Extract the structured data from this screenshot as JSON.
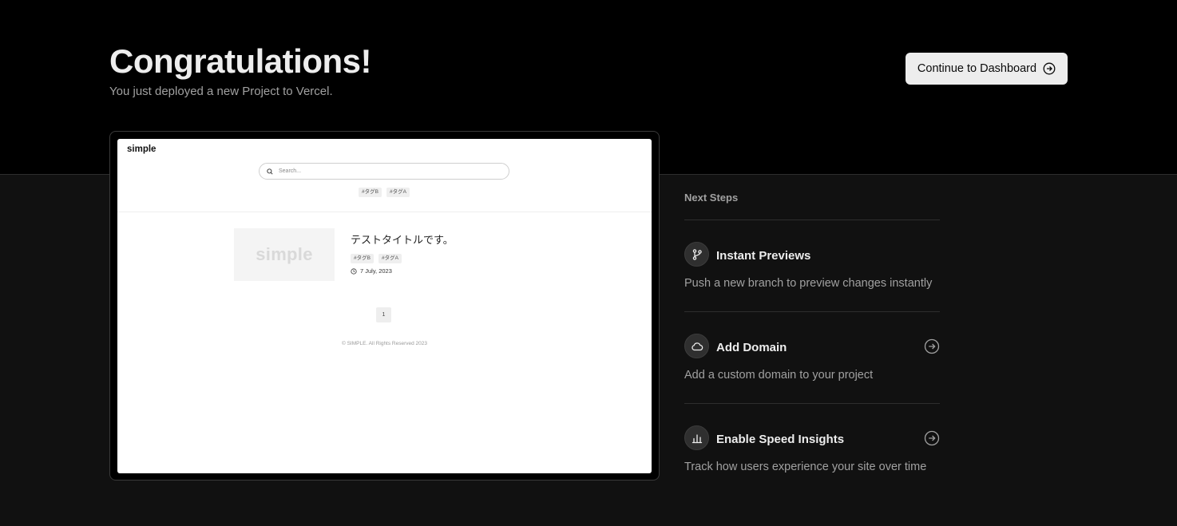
{
  "header": {
    "title": "Congratulations!",
    "subtitle": "You just deployed a new Project to Vercel.",
    "dashboard_button": "Continue to Dashboard"
  },
  "preview": {
    "logo": "simple",
    "search_placeholder": "Search...",
    "top_tags": [
      "#タグB",
      "#タグA"
    ],
    "thumbnail_text": "simple",
    "post_title": "テストタイトルです。",
    "post_tags": [
      "#タグB",
      "#タグA"
    ],
    "post_date": "7 July, 2023",
    "page_number": "1",
    "footer": "© SIMPLE. All Rights Reserved 2023"
  },
  "next_steps": {
    "heading": "Next Steps",
    "items": [
      {
        "title": "Instant Previews",
        "description": "Push a new branch to preview changes instantly",
        "icon": "git-branch-icon",
        "has_arrow": false
      },
      {
        "title": "Add Domain",
        "description": "Add a custom domain to your project",
        "icon": "cloud-icon",
        "has_arrow": true
      },
      {
        "title": "Enable Speed Insights",
        "description": "Track how users experience your site over time",
        "icon": "bar-chart-icon",
        "has_arrow": true
      }
    ]
  },
  "colors": {
    "top_background": "#000000",
    "page_background": "#111111",
    "primary_text": "#ededed",
    "secondary_text": "#a1a1a1",
    "button_background": "#ededed"
  }
}
